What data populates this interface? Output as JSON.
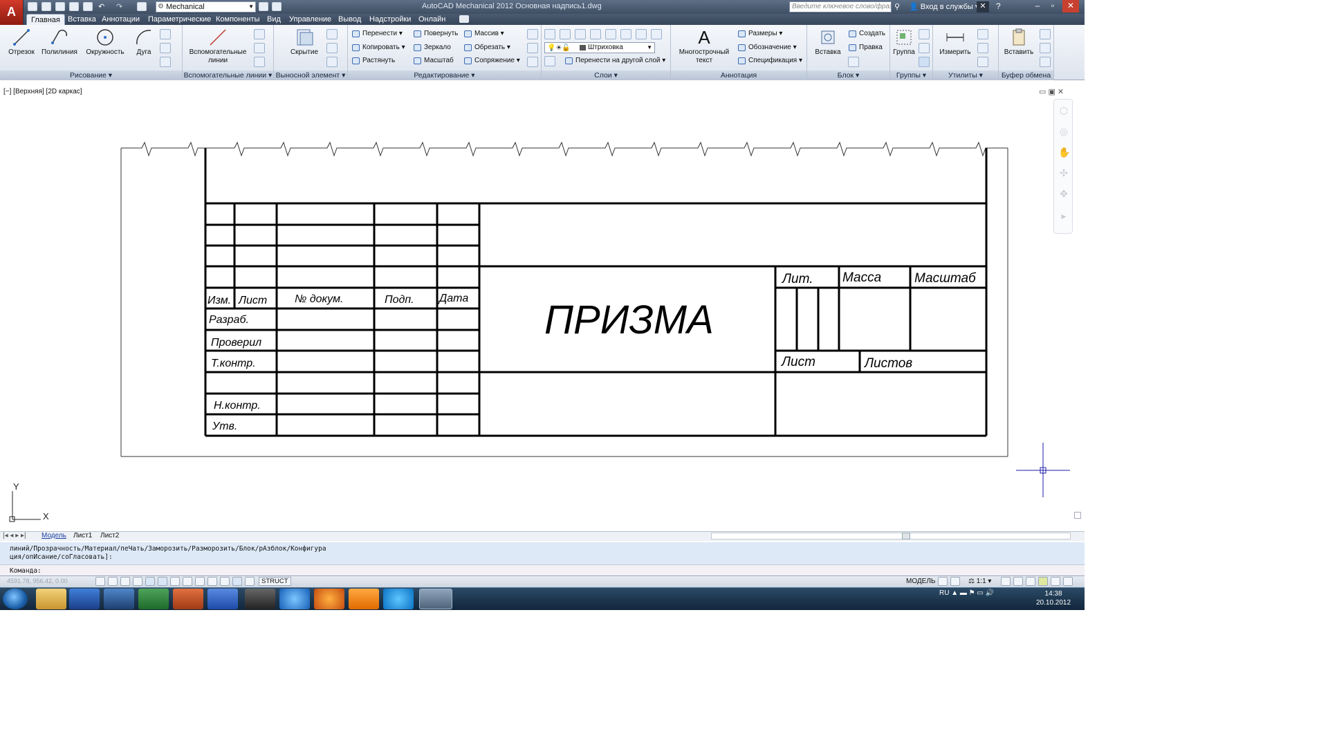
{
  "app": {
    "logo_letter": "A",
    "window_title": "AutoCAD Mechanical 2012    Основная надпись1.dwg",
    "workspace": "Mechanical",
    "search_placeholder": "Введите ключевое слово/фразу",
    "login": "Вход в службы"
  },
  "tabs": [
    "Главная",
    "Вставка",
    "Аннотации",
    "Параметрические",
    "Компоненты",
    "Вид",
    "Управление",
    "Вывод",
    "Надстройки",
    "Онлайн"
  ],
  "ribbon": {
    "draw": {
      "title": "Рисование",
      "line": "Отрезок",
      "polyline": "Полилиния",
      "circle": "Окружность",
      "arc": "Дуга"
    },
    "aux": {
      "title": "Вспомогательные линии",
      "aux_lines": "Вспомогательные линии"
    },
    "detail": {
      "title": "Выносной элемент",
      "hide": "Скрытие"
    },
    "modify": {
      "title": "Редактирование",
      "move": "Перенести",
      "rotate": "Повернуть",
      "array": "Массив",
      "copy": "Копировать",
      "mirror": "Зеркало",
      "trim": "Обрезать",
      "stretch": "Растянуть",
      "scale": "Масштаб",
      "fillet": "Сопряжение"
    },
    "layers": {
      "title": "Слои",
      "layer_value": "Штриховка",
      "move_to_layer": "Перенести на другой слой"
    },
    "annotation": {
      "title": "Аннотация",
      "mtext": "Многострочный текст",
      "dimensions": "Размеры",
      "designation": "Обозначение",
      "spec": "Спецификация"
    },
    "block": {
      "title": "Блок",
      "insert": "Вставка",
      "create": "Создать",
      "edit": "Правка"
    },
    "groups": {
      "title": "Группы",
      "group": "Группа"
    },
    "utils": {
      "title": "Утилиты",
      "measure": "Измерить"
    },
    "clipboard": {
      "title": "Буфер обмена",
      "paste": "Вставить"
    }
  },
  "viewport": {
    "label": "[−] [Верхняя] [2D каркас]",
    "axis_x": "X",
    "axis_y": "Y"
  },
  "title_block": {
    "hdr_change": "Изм.",
    "hdr_sheet": "Лист",
    "hdr_doc": "№ докум.",
    "hdr_sign": "Подп.",
    "hdr_date": "Дата",
    "row_dev": "Разраб.",
    "row_check": "Проверил",
    "row_tcontr": "Т.контр.",
    "row_ncontr": "Н.контр.",
    "row_appr": "Утв.",
    "name": "ПРИЗМА",
    "lit": "Лит.",
    "mass": "Масса",
    "scale": "Масштаб",
    "sheet": "Лист",
    "sheets": "Листов"
  },
  "layout_tabs": [
    "Модель",
    "Лист1",
    "Лист2"
  ],
  "command": {
    "history_1": "линий/Прозрачность/Материал/пеЧать/Заморозить/Разморозить/Блок/рАзблок/Конфигура",
    "history_2": "ция/опИсание/соГласовать]:",
    "prompt": "Команда:"
  },
  "status": {
    "coords": "4591.78, 956.42, 0.00",
    "struct": "STRUCT",
    "model": "МОДЕЛЬ",
    "anno_scale": "1:1"
  },
  "taskbar": {
    "lang": "RU",
    "time": "14:38",
    "date": "20.10.2012"
  },
  "colors": {
    "title_bg": "#3f4e63",
    "ribbon_bg": "#dde4ee",
    "accent": "#c8301f",
    "cmd_bg": "#dde9f7",
    "taskbar": "#1b344d"
  }
}
